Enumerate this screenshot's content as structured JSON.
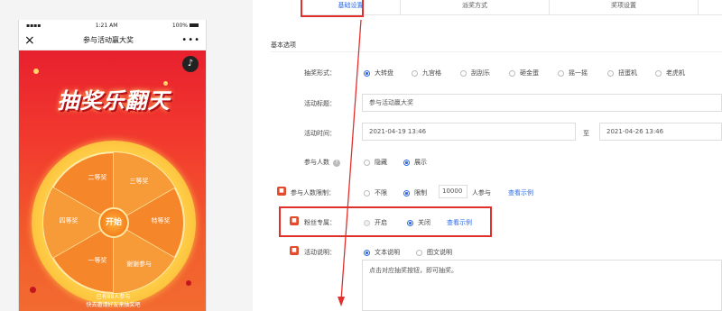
{
  "phone": {
    "status": {
      "time": "1:21 AM",
      "battery": "100%"
    },
    "nav": {
      "close": "×",
      "title": "参与活动赢大奖",
      "more": "•••"
    },
    "music_icon": "♪",
    "big_title": "抽奖乐翻天",
    "wheel": {
      "start_label": "开始",
      "prizes": [
        "二等奖",
        "三等奖",
        "特等奖",
        "谢谢参与",
        "一等奖",
        "四等奖"
      ]
    },
    "footer_line1": "已有88人参与",
    "footer_line2": "快去邀请好友来抽奖吧"
  },
  "tabs": [
    "基础设置",
    "派奖方式",
    "奖项设置"
  ],
  "section_title": "基本选项",
  "form": {
    "draw_type": {
      "label": "抽奖形式：",
      "options": [
        "大转盘",
        "九宫格",
        "刮刮乐",
        "砸金蛋",
        "摇一摇",
        "扭蛋机",
        "老虎机"
      ],
      "selected": 0
    },
    "title": {
      "label": "活动标题：",
      "value": "参与活动赢大奖"
    },
    "time": {
      "label": "活动时间：",
      "start": "2021-04-19 13:46",
      "to": "至",
      "end": "2021-04-26 13:46"
    },
    "participants": {
      "label": "参与人数",
      "options": [
        "隐藏",
        "展示"
      ],
      "selected": 1
    },
    "limit": {
      "label": "参与人数限制：",
      "options": [
        "不限",
        "限制"
      ],
      "selected": 1,
      "value": "10000",
      "suffix": "人参与",
      "example": "查看示例"
    },
    "fans": {
      "label": "粉丝专属：",
      "options": [
        "开启",
        "关闭"
      ],
      "selected": 1,
      "example": "查看示例"
    },
    "desc": {
      "label": "活动说明：",
      "options": [
        "文本说明",
        "图文说明"
      ],
      "selected": 0,
      "value": "点击对应抽奖按钮，即可抽奖。"
    }
  },
  "colors": {
    "accent": "#2f6ae6",
    "highlight": "#e0302e",
    "promo_red": "#e8202e"
  }
}
